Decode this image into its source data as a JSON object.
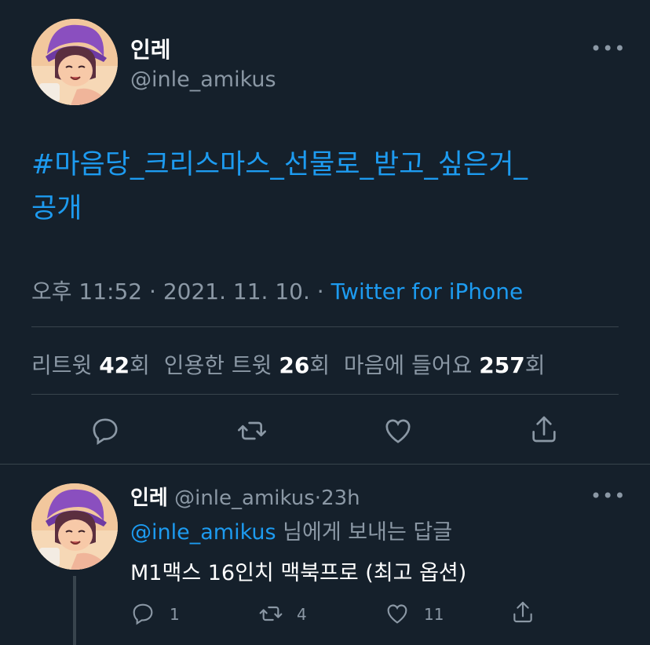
{
  "tweet": {
    "display_name": "인레",
    "handle": "@inle_amikus",
    "more_label": "•••",
    "text_line1": "#마음당_크리스마스_선물로_받고_싶은거_",
    "text_line2": "공개",
    "time": "오후 11:52",
    "sep": "·",
    "date": "2021. 11. 10.",
    "source": "Twitter for iPhone",
    "stats": {
      "retweets_label": "리트윗",
      "retweets_count": "42",
      "retweets_suffix": "회",
      "quotes_label": "인용한 트윗",
      "quotes_count": "26",
      "quotes_suffix": "회",
      "likes_label": "마음에 들어요",
      "likes_count": "257",
      "likes_suffix": "회"
    },
    "actions": [
      "reply-icon",
      "retweet-icon",
      "like-icon",
      "share-icon"
    ]
  },
  "reply": {
    "display_name": "인레",
    "handle": "@inle_amikus",
    "sep": "·",
    "time": "23h",
    "more_label": "•••",
    "mention": "@inle_amikus",
    "replying_suffix": "님에게 보내는 답글",
    "text": "M1맥스 16인치 맥북프로 (최고 옵션)",
    "reply_count": "1",
    "retweet_count": "4",
    "like_count": "11"
  },
  "colors": {
    "background": "#15202b",
    "accent": "#1d9bf0",
    "secondary_text": "#8b98a5",
    "divider": "#38444d"
  }
}
